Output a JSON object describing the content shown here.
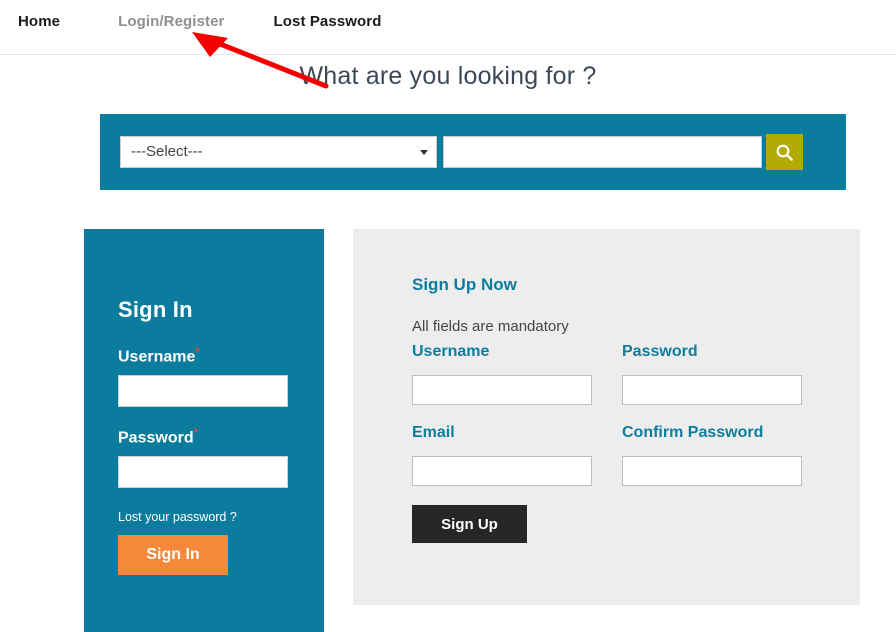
{
  "nav": {
    "items": [
      {
        "label": "Home",
        "state": "active"
      },
      {
        "label": "Login/Register",
        "state": "muted"
      },
      {
        "label": "Lost Password",
        "state": "active"
      }
    ]
  },
  "heading": {
    "text": "What are you looking for ?"
  },
  "annotation": {
    "type": "arrow",
    "color": "#f40000",
    "points_to": "Login/Register"
  },
  "search": {
    "band_color": "#0b7c9e",
    "category": {
      "selected": "---Select---",
      "options": [
        "---Select---"
      ]
    },
    "query": {
      "value": "",
      "placeholder": ""
    },
    "button": {
      "icon": "search-icon",
      "color": "#b3aa06"
    }
  },
  "signin": {
    "panel_color": "#0b7c9e",
    "title": "Sign In",
    "username": {
      "label": "Username",
      "required_marker": "*",
      "value": "",
      "placeholder": ""
    },
    "password": {
      "label": "Password",
      "required_marker": "*",
      "value": "",
      "placeholder": ""
    },
    "lost_password_link": "Lost your password ?",
    "submit_label": "Sign In",
    "submit_color": "#f6883c"
  },
  "signup": {
    "panel_color": "#ededed",
    "title": "Sign Up Now",
    "note": "All fields are mandatory",
    "accent_color": "#0d7da0",
    "fields": {
      "username": {
        "label": "Username",
        "value": "",
        "placeholder": ""
      },
      "password": {
        "label": "Password",
        "value": "",
        "placeholder": ""
      },
      "email": {
        "label": "Email",
        "value": "",
        "placeholder": ""
      },
      "confirm_password": {
        "label": "Confirm Password",
        "value": "",
        "placeholder": ""
      }
    },
    "submit_label": "Sign Up",
    "submit_color": "#262626"
  }
}
